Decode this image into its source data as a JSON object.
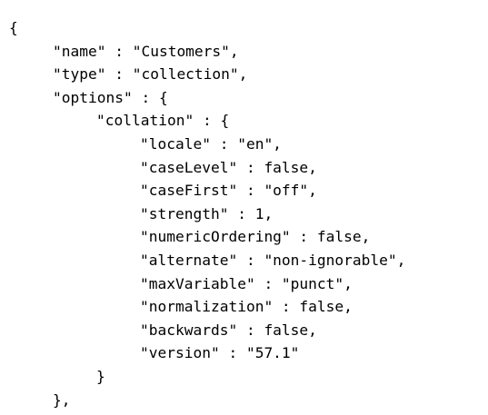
{
  "code": {
    "lines": [
      "{",
      "\"name\" : \"Customers\",",
      "\"type\" : \"collection\",",
      "\"options\" : {",
      "\"collation\" : {",
      "\"locale\" : \"en\",",
      "\"caseLevel\" : false,",
      "\"caseFirst\" : \"off\",",
      "\"strength\" : 1,",
      "\"numericOrdering\" : false,",
      "\"alternate\" : \"non-ignorable\",",
      "\"maxVariable\" : \"punct\",",
      "\"normalization\" : false,",
      "\"backwards\" : false,",
      "\"version\" : \"57.1\"",
      "}",
      "},"
    ]
  }
}
